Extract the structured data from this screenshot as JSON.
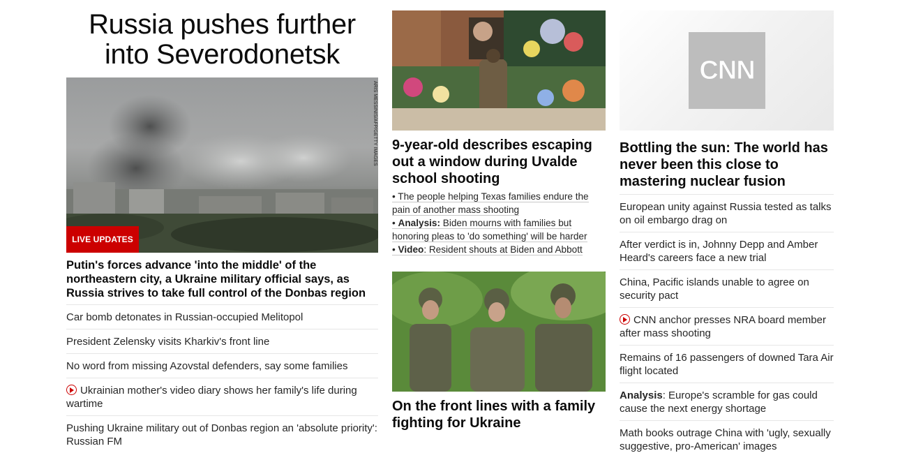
{
  "banner": {
    "title": "Russia pushes further into Severodonetsk"
  },
  "main_story": {
    "image_credit": "ARIS MESSINIS/AFP/GETTY IMAGES",
    "badge": "LIVE UPDATES",
    "headline": "Putin's forces advance 'into the middle' of the northeastern city, a Ukraine military official says, as Russia strives to take full control of the Donbas region",
    "related": [
      {
        "text": "Car bomb detonates in Russian-occupied Melitopol",
        "video": false
      },
      {
        "text": "President Zelensky visits Kharkiv's front line",
        "video": false
      },
      {
        "text": "No word from missing Azovstal defenders, say some families",
        "video": false
      },
      {
        "text": "Ukrainian mother's video diary shows her family's life during wartime",
        "video": true
      },
      {
        "text": "Pushing Ukraine military out of Donbas region an 'absolute priority': Russian FM",
        "video": false
      }
    ]
  },
  "uvalde_story": {
    "headline": "9-year-old describes escaping out a window during Uvalde school shooting",
    "bullets": [
      {
        "prefix": "• ",
        "bold": "",
        "text": "The people helping Texas families endure the pain of another mass shooting"
      },
      {
        "prefix": "• ",
        "bold": "Analysis:",
        "text": " Biden mourns with families but honoring pleas to 'do something' will be harder"
      },
      {
        "prefix": "• ",
        "bold": "Video",
        "text": ": Resident shouts at Biden and Abbott"
      }
    ]
  },
  "front_lines_story": {
    "headline": "On the front lines with a family fighting for Ukraine"
  },
  "fusion_story": {
    "logo_text": "CNN",
    "headline": "Bottling the sun: The world has never been this close to mastering nuclear fusion",
    "related": [
      {
        "bold": "",
        "text": "European unity against Russia tested as talks on oil embargo drag on",
        "video": false
      },
      {
        "bold": "",
        "text": "After verdict is in, Johnny Depp and Amber Heard's careers face a new trial",
        "video": false
      },
      {
        "bold": "",
        "text": "China, Pacific islands unable to agree on security pact",
        "video": false
      },
      {
        "bold": "",
        "text": "CNN anchor presses NRA board member after mass shooting",
        "video": true
      },
      {
        "bold": "",
        "text": "Remains of 16 passengers of downed Tara Air flight located",
        "video": false
      },
      {
        "bold": "Analysis",
        "text": ": Europe's scramble for gas could cause the next energy shortage",
        "video": false
      },
      {
        "bold": "",
        "text": "Math books outrage China with 'ugly, sexually suggestive, pro-American' images",
        "video": false
      }
    ]
  },
  "colors": {
    "accent_red": "#cc0000",
    "text": "#0c0c0c",
    "divider": "#e6e6e6"
  }
}
